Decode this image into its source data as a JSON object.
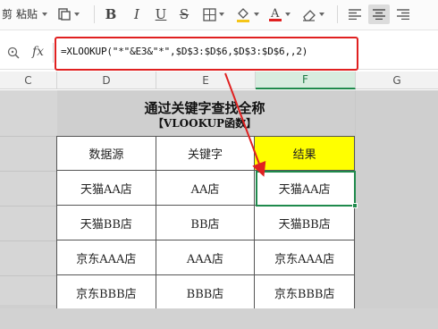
{
  "toolbar": {
    "cut_label": "剪",
    "paste_label": "粘贴",
    "font_color": "#e02020",
    "fill_color": "#f5c518"
  },
  "formula_bar": {
    "fx_label": "fx",
    "formula": "=XLOOKUP(\"*\"&E3&\"*\",$D$3:$D$6,$D$3:$D$6,,2)"
  },
  "columns": [
    "C",
    "D",
    "E",
    "F",
    "G"
  ],
  "active_column": "F",
  "title": {
    "main": "通过关键字查找全称",
    "sub": "【VLOOKUP函数】"
  },
  "table": {
    "headers": [
      "数据源",
      "关键字",
      "结果"
    ],
    "rows": [
      [
        "天猫AA店",
        "AA店",
        "天猫AA店"
      ],
      [
        "天猫BB店",
        "BB店",
        "天猫BB店"
      ],
      [
        "京东AAA店",
        "AAA店",
        "京东AAA店"
      ],
      [
        "京东BBB店",
        "BBB店",
        "京东BBB店"
      ]
    ]
  },
  "colors": {
    "highlight_border": "#e02020",
    "result_header_fill": "#ffff00",
    "selection": "#1f8a4c",
    "arrow": "#e02020"
  }
}
